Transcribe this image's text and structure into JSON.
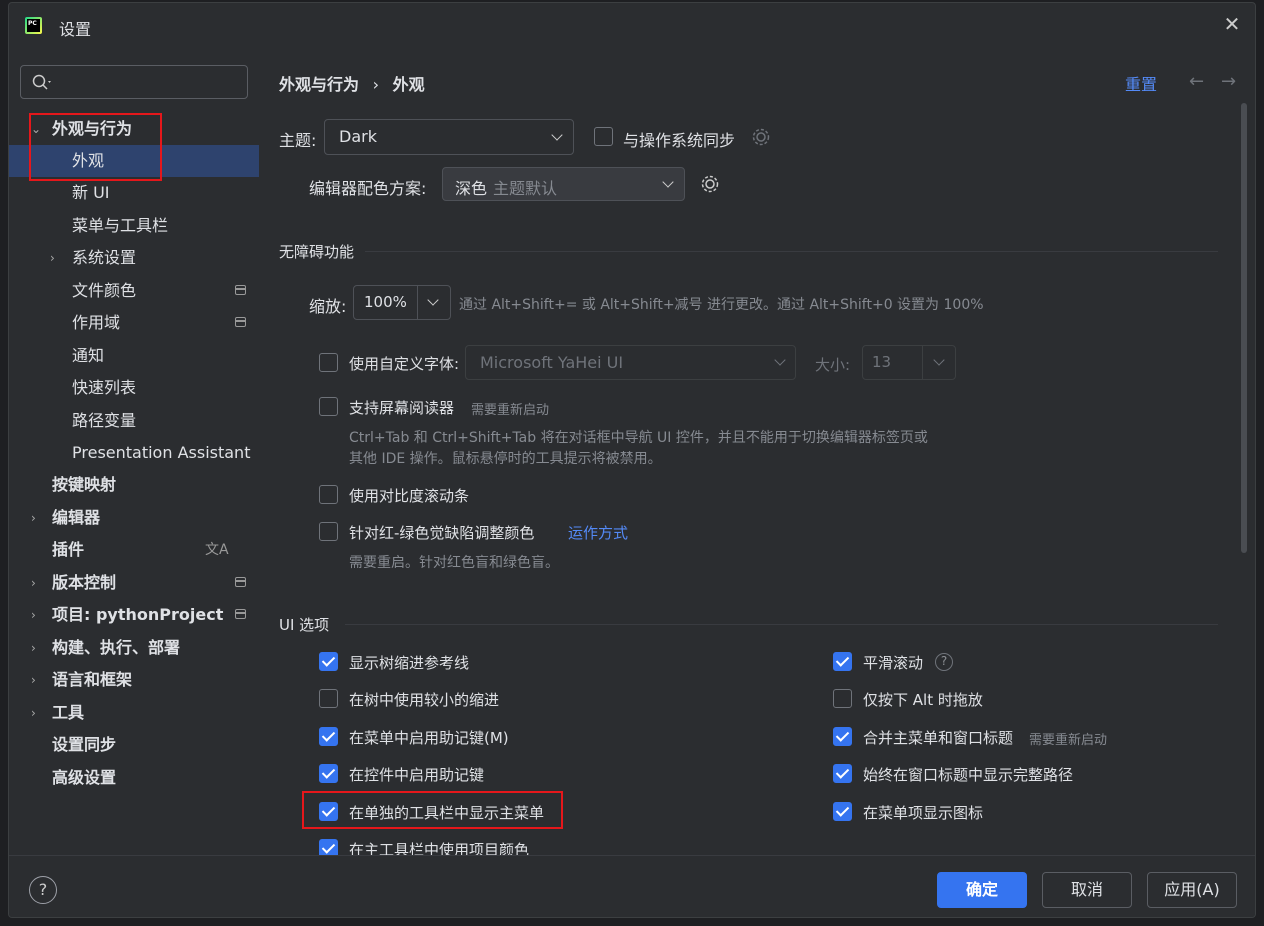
{
  "window": {
    "title": "设置"
  },
  "search": {
    "placeholder": ""
  },
  "sidebar": {
    "items": [
      {
        "label": "外观与行为",
        "expanded": true
      },
      {
        "label": "外观",
        "selected": true
      },
      {
        "label": "新 UI"
      },
      {
        "label": "菜单与工具栏"
      },
      {
        "label": "系统设置"
      },
      {
        "label": "文件颜色"
      },
      {
        "label": "作用域"
      },
      {
        "label": "通知"
      },
      {
        "label": "快速列表"
      },
      {
        "label": "路径变量"
      },
      {
        "label": "Presentation Assistant"
      },
      {
        "label": "按键映射"
      },
      {
        "label": "编辑器"
      },
      {
        "label": "插件"
      },
      {
        "label": "版本控制"
      },
      {
        "label": "项目: pythonProject"
      },
      {
        "label": "构建、执行、部署"
      },
      {
        "label": "语言和框架"
      },
      {
        "label": "工具"
      },
      {
        "label": "设置同步"
      },
      {
        "label": "高级设置"
      }
    ]
  },
  "header": {
    "crumb_parent": "外观与行为",
    "crumb_sep": "›",
    "crumb_current": "外观",
    "reset": "重置",
    "back": "←",
    "forward": "→"
  },
  "theme": {
    "label": "主题:",
    "value": "Dark",
    "sync_label": "与操作系统同步",
    "sync_checked": false
  },
  "scheme": {
    "label": "编辑器配色方案:",
    "value": "深色",
    "hint": "主题默认"
  },
  "accessibility": {
    "section": "无障碍功能",
    "zoom_label": "缩放:",
    "zoom_value": "100%",
    "zoom_hint": "通过 Alt+Shift+= 或 Alt+Shift+减号 进行更改。通过 Alt+Shift+0 设置为 100%",
    "custom_font_label": "使用自定义字体:",
    "custom_font_checked": false,
    "font_value": "Microsoft YaHei UI",
    "size_label": "大小:",
    "size_value": "13",
    "screen_reader_label": "支持屏幕阅读器",
    "screen_reader_checked": false,
    "screen_reader_hint": "需要重新启动",
    "screen_reader_desc1": "Ctrl+Tab 和 Ctrl+Shift+Tab 将在对话框中导航 UI 控件，并且不能用于切换编辑器标签页或",
    "screen_reader_desc2": "其他 IDE 操作。鼠标悬停时的工具提示将被禁用。",
    "contrast_label": "使用对比度滚动条",
    "contrast_checked": false,
    "colorblind_label": "针对红-绿色觉缺陷调整颜色",
    "colorblind_checked": false,
    "colorblind_link": "运作方式",
    "colorblind_desc": "需要重启。针对红色盲和绿色盲。"
  },
  "ui_options": {
    "section": "UI 选项",
    "left": [
      {
        "label": "显示树缩进参考线",
        "checked": true
      },
      {
        "label": "在树中使用较小的缩进",
        "checked": false
      },
      {
        "label": "在菜单中启用助记键(M)",
        "checked": true
      },
      {
        "label": "在控件中启用助记键",
        "checked": true
      },
      {
        "label": "在单独的工具栏中显示主菜单",
        "checked": true
      },
      {
        "label": "在主工具栏中使用项目颜色",
        "checked": true
      }
    ],
    "right": [
      {
        "label": "平滑滚动",
        "checked": true,
        "help": "?"
      },
      {
        "label": "仅按下 Alt 时拖放",
        "checked": false
      },
      {
        "label": "合并主菜单和窗口标题",
        "checked": true,
        "hint": "需要重新启动"
      },
      {
        "label": "始终在窗口标题中显示完整路径",
        "checked": true
      },
      {
        "label": "在菜单项显示图标",
        "checked": true
      }
    ]
  },
  "footer": {
    "help": "?",
    "ok": "确定",
    "cancel": "取消",
    "apply": "应用(A)"
  },
  "colors": {
    "accent": "#3574f0",
    "link": "#548af7",
    "highlight": "#e5171b"
  }
}
